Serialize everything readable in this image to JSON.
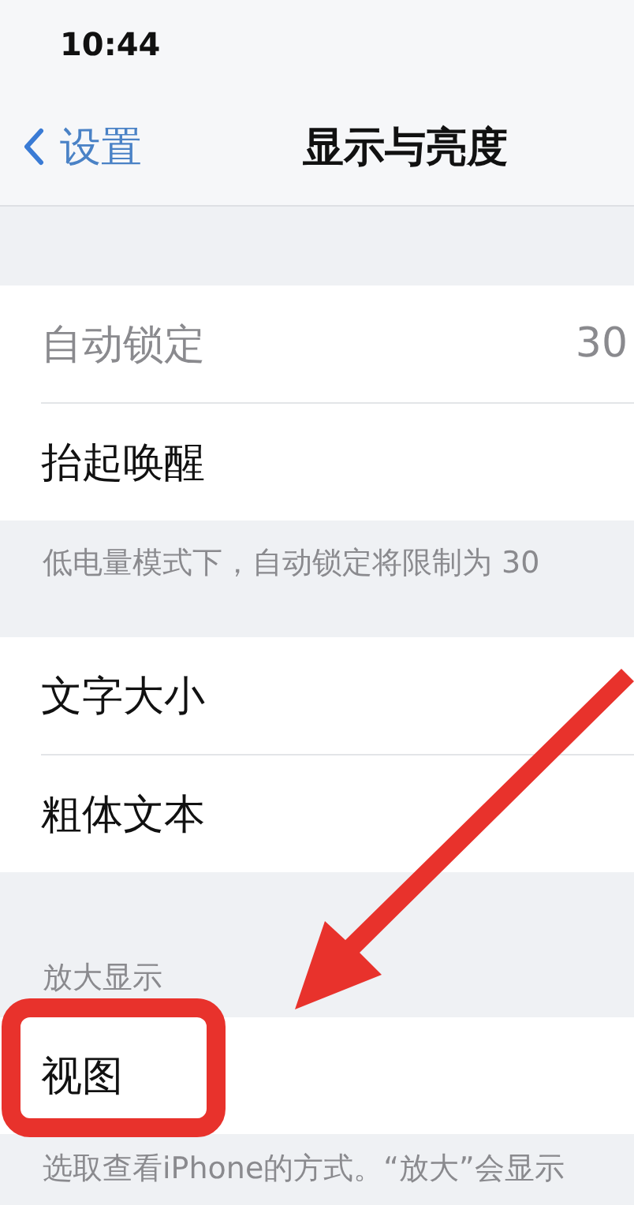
{
  "status_bar": {
    "time": "10:44"
  },
  "nav": {
    "back": "设置",
    "title": "显示与亮度"
  },
  "sections": [
    {
      "rows": [
        {
          "label": "自动锁定",
          "value": "30",
          "disabled": true
        },
        {
          "label": "抬起唤醒",
          "disabled": false
        }
      ],
      "footer": "低电量模式下，自动锁定将限制为 30"
    },
    {
      "rows": [
        {
          "label": "文字大小",
          "disabled": false
        },
        {
          "label": "粗体文本",
          "disabled": false
        }
      ]
    },
    {
      "header": "放大显示",
      "rows": [
        {
          "label": "视图",
          "disabled": false
        }
      ],
      "footer": "选取查看iPhone的方式。“放大”会显示"
    }
  ]
}
